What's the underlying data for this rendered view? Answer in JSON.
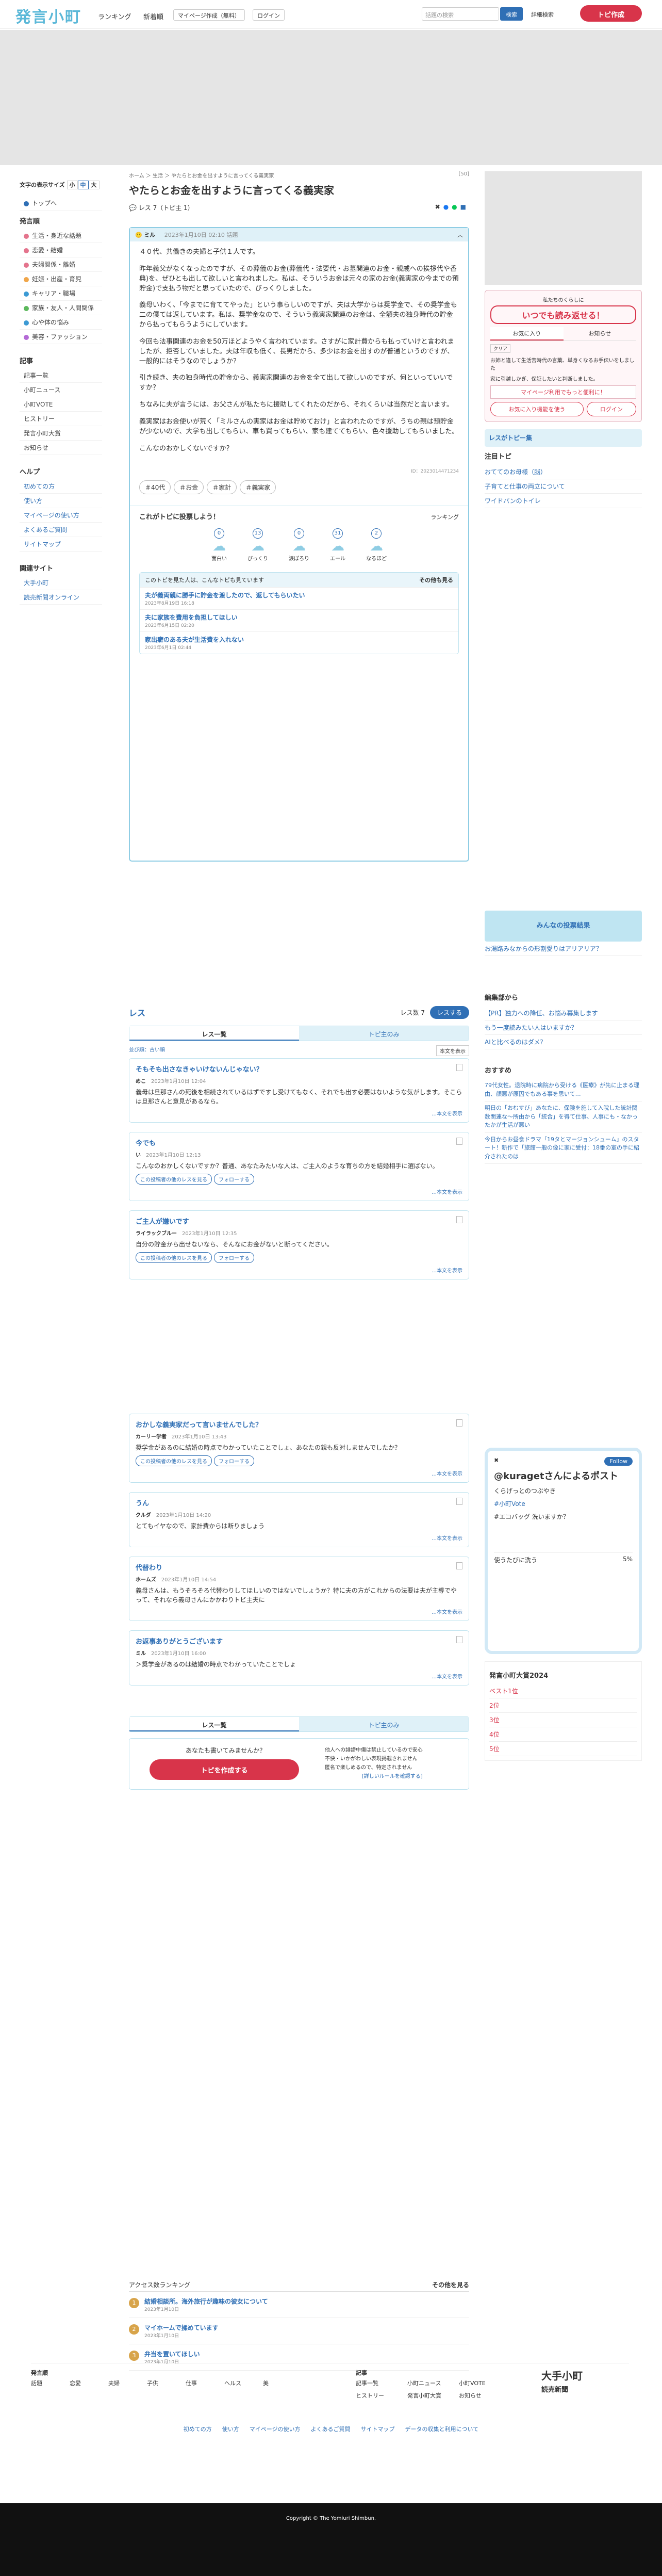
{
  "header": {
    "logo": "発言小町",
    "nav_ranking": "ランキング",
    "nav_new": "新着順",
    "nav_mypage": "マイページ作成（無料）",
    "nav_login": "ログイン",
    "search_placeholder": "話題の検索",
    "search_button": "検索",
    "detail_search": "詳細検索",
    "new_topic": "トピ作成"
  },
  "sidebar": {
    "fontsize_label": "文字の表示サイズ",
    "fs_small": "小",
    "fs_mid": "中",
    "fs_large": "大",
    "home": "トップへ",
    "topics_head": "発言順",
    "categories": [
      {
        "label": "生活・身近な話題",
        "color": "#e4748d"
      },
      {
        "label": "恋愛・結婚",
        "color": "#e4748d"
      },
      {
        "label": "夫婦関係・離婚",
        "color": "#e4748d"
      },
      {
        "label": "妊娠・出産・育児",
        "color": "#f0a64a"
      },
      {
        "label": "キャリア・職場",
        "color": "#3c9ad4"
      },
      {
        "label": "家族・友人・人間関係",
        "color": "#5cb85c"
      },
      {
        "label": "心や体の悩み",
        "color": "#3c9ad4"
      },
      {
        "label": "美容・ファッション",
        "color": "#b46ad6"
      }
    ],
    "articles_head": "記事",
    "articles": [
      "記事一覧",
      "小町ニュース",
      "小町VOTE",
      "ヒストリー",
      "発言小町大賞",
      "お知らせ"
    ],
    "help_head": "ヘルプ",
    "help": [
      "初めての方",
      "使い方",
      "マイページの使い方",
      "よくあるご質問",
      "サイトマップ"
    ],
    "related_head": "関連サイト",
    "related": [
      "大手小町",
      "読売新聞オンライン"
    ]
  },
  "topic": {
    "breadcrumb": "ホーム ＞ 生活 ＞ やたらとお金を出すように言ってくる義実家",
    "views": "[50]",
    "title": "やたらとお金を出すように言ってくる義実家",
    "res_count": "レス 7",
    "tobi_count": "（トピ主 1）",
    "author": "ミル",
    "date": "2023年1月10日 02:10",
    "badge": "話題",
    "body": [
      "４０代、共働きの夫婦と子供１人です。",
      "昨年義父がなくなったのですが、その葬儀のお金(葬儀代・法要代・お墓関連のお金・親戚への挨拶代や香典)を、ぜひとも出して欲しいと言われました。私は、そういうお金は元々の家のお金(義実家の今までの預貯金)で支払う物だと思っていたので、びっくりしました。",
      "義母いわく、「今までに育ててやった」という事らしいのですが、夫は大学からは奨学金で、その奨学金も二の僕ては返しています。私は、奨学金なので、そういう義実家関連のお金は、全額夫の独身時代の貯金から払ってもらうようにしています。",
      "今回も法事関連のお金を50万ほどようやく言われています。さすがに家計費からも払っていけと言われましたが、拒否していました。夫は年収も低く、長男だから、多少はお金を出すのが普通というのですが、一般的にはそうなのでしょうか？",
      "引き続き、夫の独身時代の貯金から、義実家関連のお金を全て出して欲しいのですが、何といっていいですか？",
      "ちなみに夫が言うには、お父さんが私たちに援助してくれたのだから、それくらいは当然だと言います。",
      "義実家はお金使いが荒く「ミルさんの実家はお金は貯めておけ」と言われたのですが、うちの親は預貯金が少ないので、大学も出してもらい、車も買ってもらい、家も建ててもらい、色々援助してもらいました。",
      "こんなのおかしくないですか？"
    ],
    "id_line": "ID：2023014471234",
    "tags": [
      "＃40代",
      "＃お金",
      "＃家計",
      "＃義実家"
    ]
  },
  "reaction": {
    "title": "これがトピに投票しよう！",
    "ranking": "ランキング",
    "items": [
      {
        "label": "面白い",
        "count": "0"
      },
      {
        "label": "びっくり",
        "count": "13"
      },
      {
        "label": "涙ぽろり",
        "count": "0"
      },
      {
        "label": "エール",
        "count": "31"
      },
      {
        "label": "なるほど",
        "count": "2"
      }
    ]
  },
  "related_topics": {
    "head": "このトピを見た人は、こんなトピも見ています",
    "more": "その他も見る",
    "items": [
      {
        "title": "夫が義両親に勝手に貯金を渡したので、返してもらいたい",
        "meta": "2023年8月19日 16:18"
      },
      {
        "title": "夫に家族を費用を負担してほしい",
        "meta": "2023年6月15日 02:20"
      },
      {
        "title": "家出癖のある夫が生活費を入れない",
        "meta": "2023年6月1日 02:44"
      }
    ]
  },
  "sharebar": {
    "label": "私たちのくらしに",
    "title": "いつでも読み返せる！",
    "tab_fav": "お気に入り",
    "tab_notice": "お知らせ",
    "clear": "クリア",
    "item1": "お姉と違して生活苦時代の言葉、単身くなるお手伝いをしました",
    "item2": "家に引越しかぎ、保証したいと判断しました。",
    "mypage_cta": "マイページ利用でもっと便利に！",
    "fav_btn": "お気に入り機能を使う",
    "login_btn": "ログイン"
  },
  "right": {
    "res_tobi": "レスがトピー集",
    "notice_head": "注目トピ",
    "notice": [
      "おててのお母様（脳）",
      "子育てと仕事の両立について",
      "ワイドパンのトイレ"
    ],
    "banner": "みんなの投票結果",
    "banner_link": "お湯路みなからの形割愛りはアリアリア？",
    "editor_head": "編集部から",
    "editor": [
      "【PR】独力への降任、お悩み募集します",
      "もう一度読みたい人はいますか？",
      "AIと比べるのはダメ？"
    ],
    "osusume_head": "おすすめ",
    "osusume": [
      "79代女性。退院時に病院から受ける《医療》が先に止まる理由、顔悪が原因でもある事を思いて…",
      "明日の「おむすび」あなたに、保険を施して入院した統計関数関連な～所由から「統合」を得て仕事、人事にも・なかったかが生活が悪い",
      "今日からお昼食ドラマ「19タとマージョンシューム」のスタート！新作で「旅館一般の像に家に受付：18番の室の手に紹介されたのは"
    ],
    "twitter_name": "くらげっとのつぶやき",
    "twitter_handle": "@k...",
    "tweet": "@kuragetさんによるポスト",
    "tweet_tag": "#小町Vote",
    "tweet_body": "#エコバッグ 洗いますか？",
    "follow": "Follow",
    "vote_pct": "5%",
    "vote_opt": "使うたびに洗う",
    "award_head": "発言小町大賞2024",
    "award_items": [
      "ベスト1位",
      "2位",
      "3位",
      "4位",
      "5位"
    ]
  },
  "responses": {
    "title": "レス",
    "count": "レス数 7",
    "write": "レスする",
    "tab_all": "レス一覧",
    "tab_tobi": "トピ主のみ",
    "filter_label": "並び順：古い順",
    "sort_label": "本文を表示",
    "items": [
      {
        "title": "そもそも出さなきゃいけないんじゃない？",
        "author": "めこ",
        "date": "2023年1月10日 12:04",
        "body": "義母は旦那さんの死後を相続されているはずですし受けてもなく、それでも出す必要はないような気がします。そこらは旦那さんと意見があるなら。"
      },
      {
        "title": "今でも",
        "author": "い",
        "date": "2023年1月10日 12:13",
        "body": "こんなのおかしくないですか？普通、あなたみたいな人は、ご主人のような育ちの方を結婚相手に選ばない。"
      },
      {
        "title": "ご主人が嫌いです",
        "author": "ライラックブルー",
        "date": "2023年1月10日 12:35",
        "body": "自分の貯金から出せないなら、そんなにお金がないと断ってください。"
      },
      {
        "title": "おかしな義実家だって言いませんでした？",
        "author": "カーリー学者",
        "date": "2023年1月10日 13:43",
        "body": "奨学金があるのに結婚の時点でわかっていたことでしょ、あなたの親も反対しませんでしたか？"
      },
      {
        "title": "うん",
        "author": "クルダ",
        "date": "2023年1月10日 14:20",
        "body": "とてもイヤなので、家計費からは断りましょう"
      },
      {
        "title": "代替わり",
        "author": "ホームズ",
        "date": "2023年1月10日 14:54",
        "body": "義母さんは、もうそろそろ代替わりしてほしいのではないでしょうか？特に夫の方がこれからの法要は夫が主導でやって、それなら義母さんにかかわりトビ主夫に"
      },
      {
        "title": "お返事ありがとうございます",
        "author": "ミル",
        "date": "2023年1月10日 16:00",
        "body": "＞奨学金があるのは結婚の時点でわかっていたことでしょ"
      }
    ],
    "more_label": "…本文を表示",
    "follow_label": "フォローする",
    "other_label": "この投稿者の他のレスを見る"
  },
  "bottom_cta": {
    "text": "あなたも書いてみませんか？",
    "button": "トピを作成する",
    "check1": "他人への誹謗中傷は禁止しているので安心",
    "check2": "不快・いかがわしい表現掲載されません",
    "check3": "匿名で楽しめるので、特定されません",
    "link": "[詳しいルールを確認する]"
  },
  "access_ranking": {
    "head": "アクセス数ランキング",
    "more": "その他を見る",
    "items": [
      {
        "title": "結婚相談所。海外旅行が趣味の彼女について",
        "meta": "2023年1月10日"
      },
      {
        "title": "マイホームで揉めています",
        "meta": "2023年1月10日"
      },
      {
        "title": "弁当を置いてほしい",
        "meta": "2023年1月10日"
      }
    ]
  },
  "foot": {
    "left_head": "発言順",
    "left_items": [
      "話題",
      "恋愛",
      "夫婦",
      "子供",
      "仕事",
      "ヘルス",
      "美"
    ],
    "mid_head": "記事",
    "mid_items": [
      "記事一覧",
      "小町ニュース",
      "小町VOTE",
      "ヒストリー",
      "発言小町大賞",
      "お知らせ"
    ],
    "brand1": "大手小町",
    "brand2": "読売新聞",
    "links": [
      "初めての方",
      "使い方",
      "マイページの使い方",
      "よくあるご質問",
      "サイトマップ",
      "データの収集と利用について"
    ],
    "copyright": "Copyright © The Yomiuri Shimbun."
  }
}
